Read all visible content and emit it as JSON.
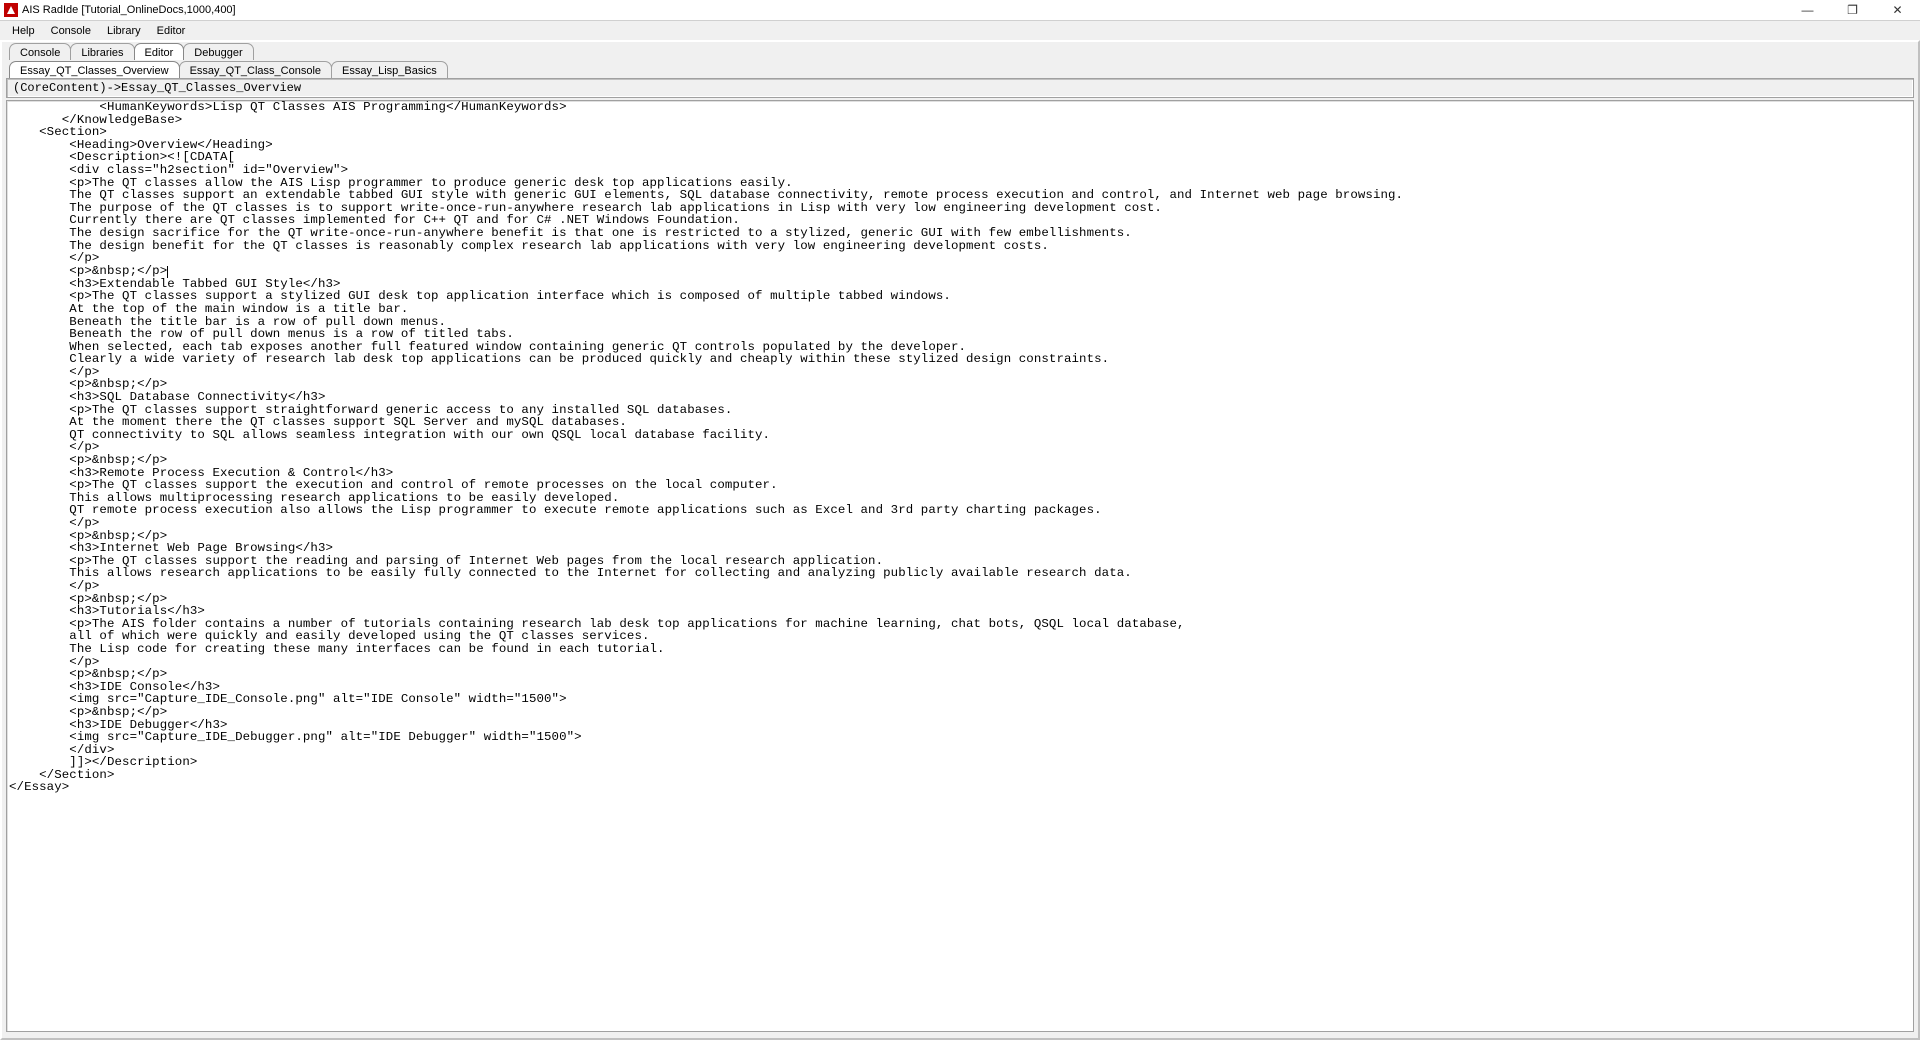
{
  "window": {
    "title": "AIS RadIde [Tutorial_OnlineDocs,1000,400]",
    "minimize": "—",
    "maximize": "❐",
    "close": "✕"
  },
  "menu": {
    "items": [
      "Help",
      "Console",
      "Library",
      "Editor"
    ]
  },
  "main_tabs": {
    "items": [
      "Console",
      "Libraries",
      "Editor",
      "Debugger"
    ],
    "active": 2
  },
  "sub_tabs": {
    "items": [
      "Essay_QT_Classes_Overview",
      "Essay_QT_Class_Console",
      "Essay_Lisp_Basics"
    ],
    "active": 0
  },
  "pathbar": "(CoreContent)->Essay_QT_Classes_Overview",
  "editor": {
    "caret_line": 13,
    "lines": [
      "            <HumanKeywords>Lisp QT Classes AIS Programming</HumanKeywords>",
      "       </KnowledgeBase>",
      "    <Section>",
      "        <Heading>Overview</Heading>",
      "        <Description><![CDATA[",
      "        <div class=\"h2section\" id=\"Overview\">",
      "        <p>The QT classes allow the AIS Lisp programmer to produce generic desk top applications easily.",
      "        The QT classes support an extendable tabbed GUI style with generic GUI elements, SQL database connectivity, remote process execution and control, and Internet web page browsing.",
      "        The purpose of the QT classes is to support write-once-run-anywhere research lab applications in Lisp with very low engineering development cost.",
      "        Currently there are QT classes implemented for C++ QT and for C# .NET Windows Foundation.",
      "        The design sacrifice for the QT write-once-run-anywhere benefit is that one is restricted to a stylized, generic GUI with few embellishments.",
      "        The design benefit for the QT classes is reasonably complex research lab applications with very low engineering development costs.",
      "        </p>",
      "        <p>&nbsp;</p>",
      "        <h3>Extendable Tabbed GUI Style</h3>",
      "        <p>The QT classes support a stylized GUI desk top application interface which is composed of multiple tabbed windows.",
      "        At the top of the main window is a title bar.",
      "        Beneath the title bar is a row of pull down menus.",
      "        Beneath the row of pull down menus is a row of titled tabs.",
      "        When selected, each tab exposes another full featured window containing generic QT controls populated by the developer.",
      "        Clearly a wide variety of research lab desk top applications can be produced quickly and cheaply within these stylized design constraints.",
      "        </p>",
      "        <p>&nbsp;</p>",
      "        <h3>SQL Database Connectivity</h3>",
      "        <p>The QT classes support straightforward generic access to any installed SQL databases.",
      "        At the moment there the QT classes support SQL Server and mySQL databases.",
      "        QT connectivity to SQL allows seamless integration with our own QSQL local database facility.",
      "        </p>",
      "        <p>&nbsp;</p>",
      "        <h3>Remote Process Execution & Control</h3>",
      "        <p>The QT classes support the execution and control of remote processes on the local computer.",
      "        This allows multiprocessing research applications to be easily developed.",
      "        QT remote process execution also allows the Lisp programmer to execute remote applications such as Excel and 3rd party charting packages.",
      "        </p>",
      "        <p>&nbsp;</p>",
      "        <h3>Internet Web Page Browsing</h3>",
      "        <p>The QT classes support the reading and parsing of Internet Web pages from the local research application.",
      "        This allows research applications to be easily fully connected to the Internet for collecting and analyzing publicly available research data.",
      "        </p>",
      "        <p>&nbsp;</p>",
      "        <h3>Tutorials</h3>",
      "        <p>The AIS folder contains a number of tutorials containing research lab desk top applications for machine learning, chat bots, QSQL local database,",
      "        all of which were quickly and easily developed using the QT classes services.",
      "        The Lisp code for creating these many interfaces can be found in each tutorial.",
      "        </p>",
      "        <p>&nbsp;</p>",
      "        <h3>IDE Console</h3>",
      "        <img src=\"Capture_IDE_Console.png\" alt=\"IDE Console\" width=\"1500\">",
      "        <p>&nbsp;</p>",
      "        <h3>IDE Debugger</h3>",
      "        <img src=\"Capture_IDE_Debugger.png\" alt=\"IDE Debugger\" width=\"1500\">",
      "        </div>",
      "        ]]></Description>",
      "    </Section>",
      "</Essay>"
    ]
  }
}
